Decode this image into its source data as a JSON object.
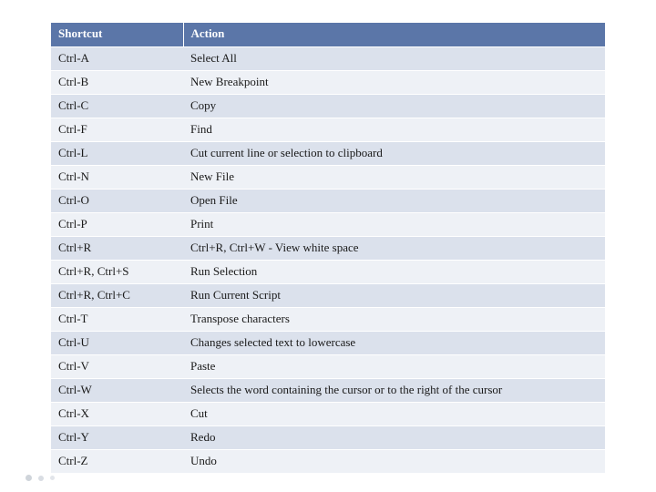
{
  "table": {
    "headers": {
      "shortcut": "Shortcut",
      "action": "Action"
    },
    "rows": [
      {
        "shortcut": "Ctrl-A",
        "action": "Select All"
      },
      {
        "shortcut": "Ctrl-B",
        "action": "New Breakpoint"
      },
      {
        "shortcut": "Ctrl-C",
        "action": "Copy"
      },
      {
        "shortcut": "Ctrl-F",
        "action": "Find"
      },
      {
        "shortcut": "Ctrl-L",
        "action": "Cut current line or selection to clipboard"
      },
      {
        "shortcut": "Ctrl-N",
        "action": "New File"
      },
      {
        "shortcut": "Ctrl-O",
        "action": "Open File"
      },
      {
        "shortcut": "Ctrl-P",
        "action": "Print"
      },
      {
        "shortcut": "Ctrl+R",
        "action": "Ctrl+R, Ctrl+W - View white space"
      },
      {
        "shortcut": "Ctrl+R, Ctrl+S",
        "action": "Run Selection"
      },
      {
        "shortcut": "Ctrl+R, Ctrl+C",
        "action": "Run Current Script"
      },
      {
        "shortcut": "Ctrl-T",
        "action": "Transpose characters"
      },
      {
        "shortcut": "Ctrl-U",
        "action": "Changes selected text to lowercase"
      },
      {
        "shortcut": "Ctrl-V",
        "action": "Paste"
      },
      {
        "shortcut": "Ctrl-W",
        "action": "Selects the word containing the cursor or to the right of the cursor"
      },
      {
        "shortcut": "Ctrl-X",
        "action": "Cut"
      },
      {
        "shortcut": "Ctrl-Y",
        "action": "Redo"
      },
      {
        "shortcut": "Ctrl-Z",
        "action": "Undo"
      }
    ]
  }
}
